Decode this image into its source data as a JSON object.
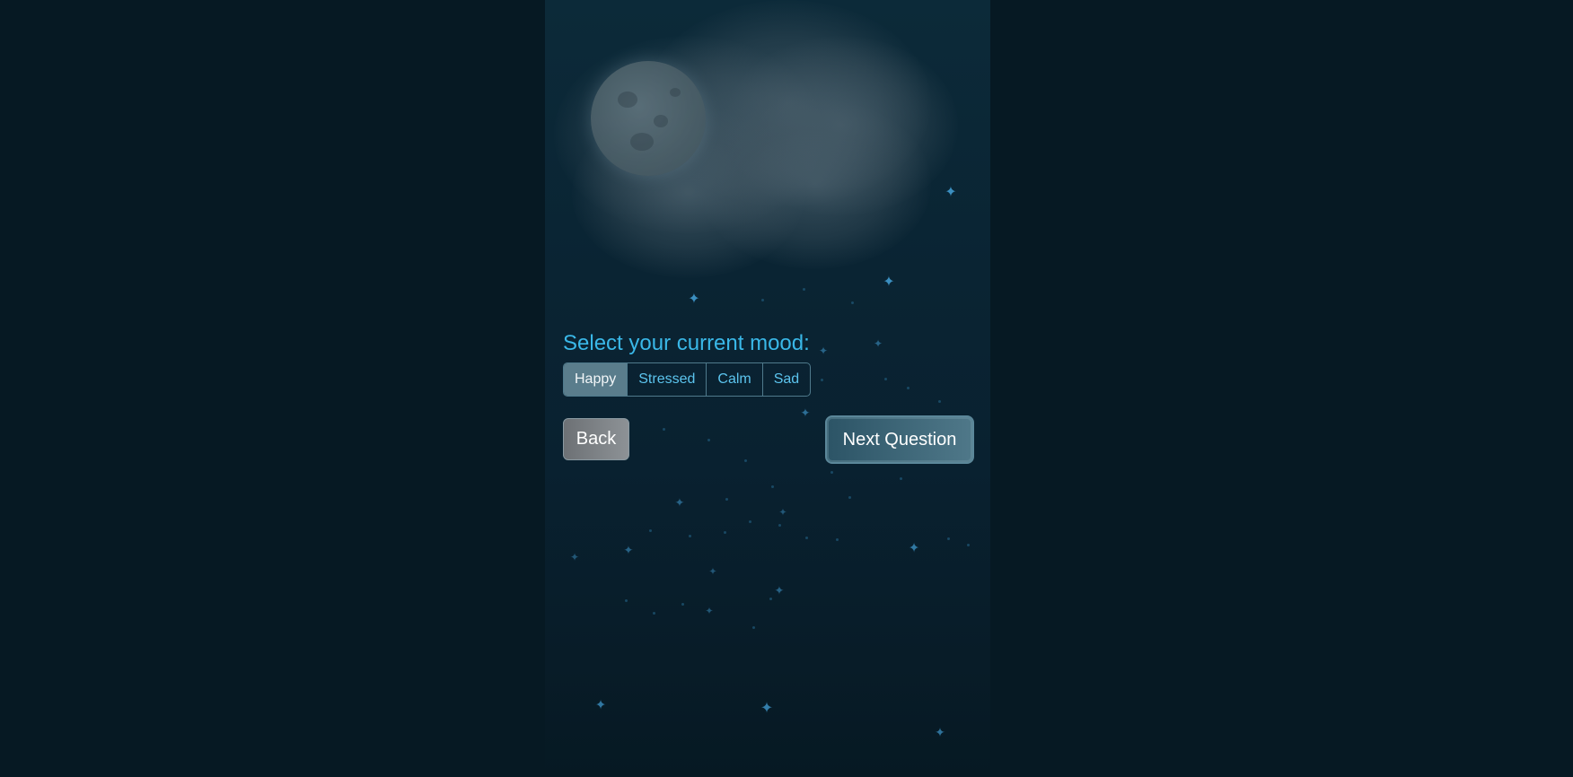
{
  "scene": {
    "decor": [
      "moon-icon",
      "cloud-icon",
      "star-icon"
    ]
  },
  "mood": {
    "label": "Select your current mood:",
    "options": [
      "Happy",
      "Stressed",
      "Calm",
      "Sad"
    ],
    "selected": "Happy"
  },
  "nav": {
    "back_label": "Back",
    "next_label": "Next Question"
  },
  "colors": {
    "accent": "#3ab8e8",
    "background": "#061923",
    "selected_option": "#5a7d8c"
  }
}
